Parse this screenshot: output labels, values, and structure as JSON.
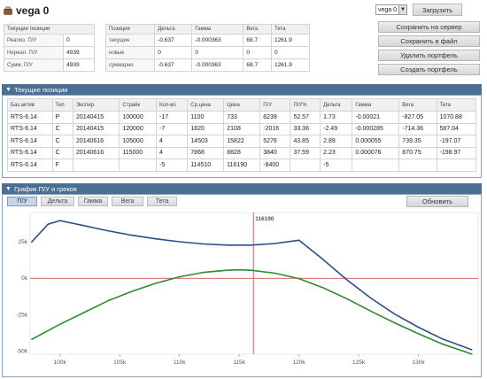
{
  "header": {
    "title": "vega 0",
    "selected_portfolio": "vega 0",
    "load_label": "Загрузить"
  },
  "actions": [
    "Сохранить на сервер",
    "Сохранить в файл",
    "Удалить портфель",
    "Создать портфель"
  ],
  "summary": {
    "header": "Текущие позиции",
    "rows": [
      {
        "label": "Реализ. П/У",
        "value": "0"
      },
      {
        "label": "Нереал. П/У",
        "value": "4939"
      },
      {
        "label": "Сумм. П/У",
        "value": "4939"
      }
    ]
  },
  "greeks_table": {
    "columns": [
      "Позиция",
      "Дельта",
      "Гамма",
      "Вега",
      "Тета"
    ],
    "rows": [
      [
        "текущие",
        "-0.637",
        "-0.000363",
        "68.7",
        "1261.9"
      ],
      [
        "новые",
        "0",
        "0",
        "0",
        "0"
      ],
      [
        "суммарно",
        "-0.637",
        "-0.000363",
        "68.7",
        "1261.9"
      ]
    ]
  },
  "positions": {
    "title": "Текущие позиции",
    "columns": [
      "Баз.актив",
      "Тип",
      "Экспир.",
      "Страйк",
      "Кол-во",
      "Ср.цена",
      "Цена",
      "П/У",
      "П/У%",
      "Дельта",
      "Гамма",
      "Вега",
      "Тета"
    ],
    "rows": [
      [
        "RTS-6.14",
        "P",
        "20140415",
        "100000",
        "-17",
        "1100",
        "733",
        "6239",
        "52.57",
        "1.73",
        "-0.00021",
        "-827.05",
        "1070.88"
      ],
      [
        "RTS-6.14",
        "C",
        "20140415",
        "120000",
        "-7",
        "1820",
        "2108",
        "-2016",
        "33.36",
        "-2.49",
        "-0.000285",
        "-714.36",
        "587.04"
      ],
      [
        "RTS-6.14",
        "C",
        "20140616",
        "105000",
        "4",
        "14503",
        "15822",
        "5276",
        "43.85",
        "2.89",
        "0.000055",
        "739.35",
        "-197.07"
      ],
      [
        "RTS-6.14",
        "C",
        "20140616",
        "115000",
        "4",
        "7868",
        "8828",
        "3840",
        "37.59",
        "2.23",
        "0.000076",
        "870.75",
        "-198.97"
      ],
      [
        "RTS-6.14",
        "F",
        "",
        "",
        "-5",
        "114510",
        "116190",
        "-8400",
        "",
        "-5",
        "",
        "",
        ""
      ]
    ]
  },
  "chart_panel": {
    "title": "График П/У и греков",
    "tabs": [
      "П/У",
      "Дельта",
      "Гамма",
      "Вега",
      "Тета"
    ],
    "active_tab": "П/У",
    "refresh_label": "Обновить"
  },
  "chart_data": {
    "type": "line",
    "current_price_label": "116190",
    "current_price": 116190,
    "xlim": [
      97500,
      135000
    ],
    "ylim": [
      -52000,
      45000
    ],
    "x_ticks": [
      "100k",
      "105k",
      "110k",
      "115k",
      "120k",
      "125k",
      "130k"
    ],
    "x_tick_values": [
      100000,
      105000,
      110000,
      115000,
      120000,
      125000,
      130000
    ],
    "y_ticks": [
      "25k",
      "0k",
      "-25k",
      "-50k"
    ],
    "y_tick_values": [
      25000,
      0,
      -25000,
      -50000
    ],
    "zero_line_color": "#c0392b",
    "series": [
      {
        "color": "#2a4f86",
        "x": [
          97600,
          99000,
          100000,
          102000,
          104000,
          106000,
          108000,
          110000,
          112000,
          114000,
          116000,
          118000,
          120000,
          122000,
          124000,
          126000,
          128000,
          130000,
          132000,
          134500
        ],
        "y": [
          24500,
          37000,
          39500,
          36000,
          32500,
          29500,
          27000,
          25000,
          23500,
          22700,
          22700,
          23800,
          26000,
          13000,
          -1000,
          -13500,
          -24500,
          -33500,
          -41500,
          -49000
        ]
      },
      {
        "color": "#2e8b2e",
        "x": [
          97600,
          100000,
          102000,
          104000,
          106000,
          108000,
          110000,
          112000,
          114000,
          115000,
          116000,
          118000,
          120000,
          122000,
          124000,
          126000,
          128000,
          130000,
          132000,
          134500
        ],
        "y": [
          -42000,
          -31500,
          -23500,
          -15500,
          -9000,
          -3500,
          1000,
          4000,
          5500,
          5800,
          5500,
          3500,
          -200,
          -6500,
          -14000,
          -22500,
          -30500,
          -38000,
          -45000,
          -52000
        ]
      }
    ]
  }
}
